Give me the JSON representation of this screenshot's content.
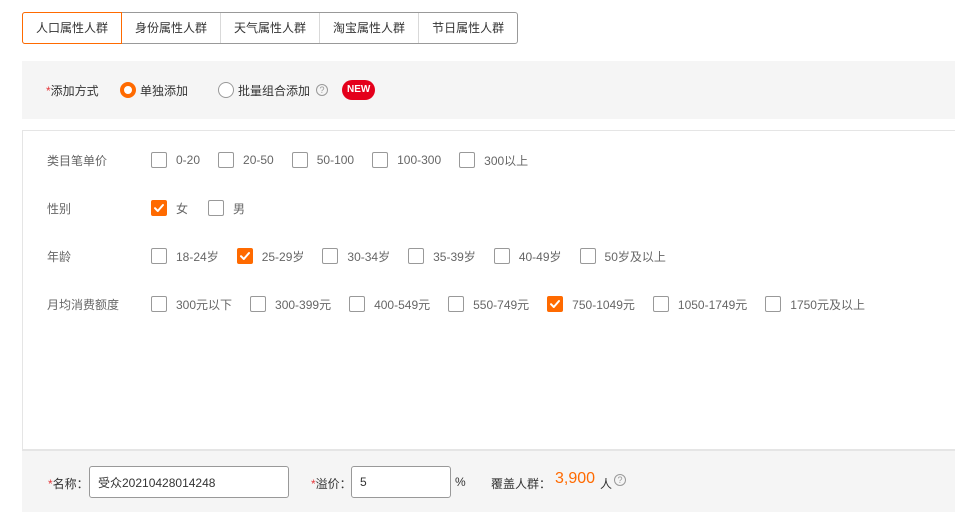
{
  "tabs": [
    {
      "label": "人口属性人群",
      "active": true
    },
    {
      "label": "身份属性人群",
      "active": false
    },
    {
      "label": "天气属性人群",
      "active": false
    },
    {
      "label": "淘宝属性人群",
      "active": false
    },
    {
      "label": "节日属性人群",
      "active": false
    }
  ],
  "mode": {
    "required_mark": "*",
    "label": "添加方式",
    "options": [
      {
        "label": "单独添加",
        "selected": true
      },
      {
        "label": "批量组合添加",
        "selected": false
      }
    ],
    "badge": "NEW"
  },
  "attributes": {
    "price": {
      "label": "类目笔单价",
      "options": [
        {
          "label": "0-20",
          "checked": false
        },
        {
          "label": "20-50",
          "checked": false
        },
        {
          "label": "50-100",
          "checked": false
        },
        {
          "label": "100-300",
          "checked": false
        },
        {
          "label": "300以上",
          "checked": false
        }
      ]
    },
    "gender": {
      "label": "性别",
      "options": [
        {
          "label": "女",
          "checked": true
        },
        {
          "label": "男",
          "checked": false
        }
      ]
    },
    "age": {
      "label": "年龄",
      "options": [
        {
          "label": "18-24岁",
          "checked": false
        },
        {
          "label": "25-29岁",
          "checked": true
        },
        {
          "label": "30-34岁",
          "checked": false
        },
        {
          "label": "35-39岁",
          "checked": false
        },
        {
          "label": "40-49岁",
          "checked": false
        },
        {
          "label": "50岁及以上",
          "checked": false
        }
      ]
    },
    "spending": {
      "label": "月均消费额度",
      "options": [
        {
          "label": "300元以下",
          "checked": false
        },
        {
          "label": "300-399元",
          "checked": false
        },
        {
          "label": "400-549元",
          "checked": false
        },
        {
          "label": "550-749元",
          "checked": false
        },
        {
          "label": "750-1049元",
          "checked": true
        },
        {
          "label": "1050-1749元",
          "checked": false
        },
        {
          "label": "1750元及以上",
          "checked": false
        }
      ]
    }
  },
  "footer": {
    "name_label": "名称：",
    "name_value": "受众20210428014248",
    "premium_label": "溢价：",
    "premium_value": "5",
    "premium_unit": "%",
    "cover_label": "覆盖人群：",
    "cover_value": "3,900",
    "cover_unit": "人",
    "required_mark": "*"
  },
  "colors": {
    "accent": "#ff6a00",
    "badge": "#e4001b",
    "required": "#e4393c"
  }
}
